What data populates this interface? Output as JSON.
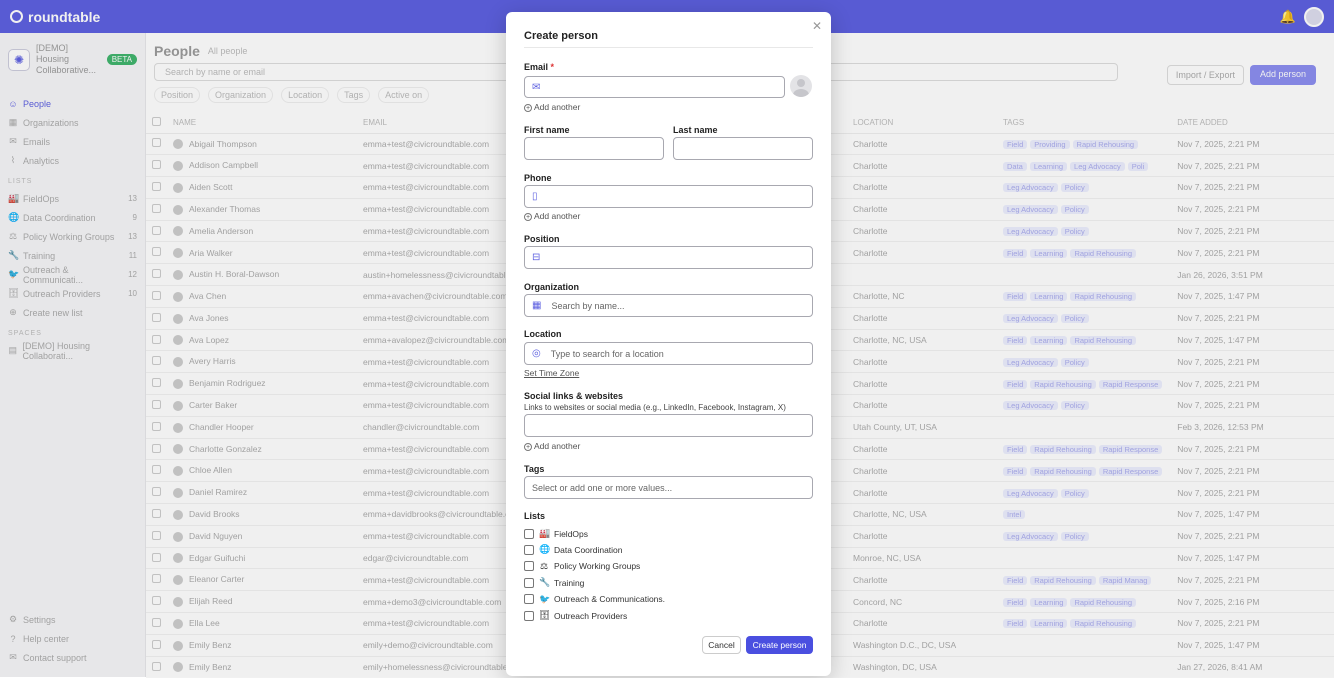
{
  "app": {
    "name": "roundtable"
  },
  "sidebar": {
    "workspace": {
      "name": "[DEMO] Housing Collaborative...",
      "badge": "BETA"
    },
    "nav": [
      {
        "label": "People",
        "icon": "people-icon",
        "active": true
      },
      {
        "label": "Organizations",
        "icon": "building-icon"
      },
      {
        "label": "Emails",
        "icon": "mail-icon"
      },
      {
        "label": "Analytics",
        "icon": "chart-icon"
      }
    ],
    "lists_heading": "LISTS",
    "lists": [
      {
        "label": "FieldOps",
        "count": "13"
      },
      {
        "label": "Data Coordination",
        "count": "9"
      },
      {
        "label": "Policy Working Groups",
        "count": "13"
      },
      {
        "label": "Training",
        "count": "11"
      },
      {
        "label": "Outreach & Communicati...",
        "count": "12"
      },
      {
        "label": "Outreach Providers",
        "count": "10"
      },
      {
        "label": "Create new list"
      }
    ],
    "spaces_heading": "SPACES",
    "spaces": [
      {
        "label": "[DEMO] Housing Collaborati..."
      }
    ],
    "bottom": [
      {
        "label": "Settings"
      },
      {
        "label": "Help center"
      },
      {
        "label": "Contact support"
      }
    ]
  },
  "main": {
    "title": "People",
    "subtitle": "All people",
    "search_placeholder": "Search by name or email",
    "import_export": "Import / Export",
    "add_person": "Add person",
    "filters": [
      "Position",
      "Organization",
      "Location",
      "Tags",
      "Active on"
    ],
    "columns": [
      "NAME",
      "EMAIL",
      "LOCATION",
      "TAGS",
      "DATE ADDED"
    ],
    "rows": [
      {
        "name": "Abigail Thompson",
        "email": "emma+test@civicroundtable.com",
        "location": "Charlotte",
        "tags": [
          "Field",
          "Providing",
          "Rapid Rehousing"
        ],
        "date": "Nov 7, 2025, 2:21 PM"
      },
      {
        "name": "Addison Campbell",
        "email": "emma+test@civicroundtable.com",
        "location": "Charlotte",
        "tags": [
          "Data",
          "Learning",
          "Leg Advocacy",
          "Poli"
        ],
        "date": "Nov 7, 2025, 2:21 PM"
      },
      {
        "name": "Aiden Scott",
        "email": "emma+test@civicroundtable.com",
        "location": "Charlotte",
        "tags": [
          "Leg Advocacy",
          "Policy"
        ],
        "date": "Nov 7, 2025, 2:21 PM"
      },
      {
        "name": "Alexander Thomas",
        "email": "emma+test@civicroundtable.com",
        "location": "Charlotte",
        "tags": [
          "Leg Advocacy",
          "Policy"
        ],
        "date": "Nov 7, 2025, 2:21 PM"
      },
      {
        "name": "Amelia Anderson",
        "email": "emma+test@civicroundtable.com",
        "location": "Charlotte",
        "tags": [
          "Leg Advocacy",
          "Policy"
        ],
        "date": "Nov 7, 2025, 2:21 PM"
      },
      {
        "name": "Aria Walker",
        "email": "emma+test@civicroundtable.com",
        "location": "Charlotte",
        "tags": [
          "Field",
          "Learning",
          "Rapid Rehousing"
        ],
        "date": "Nov 7, 2025, 2:21 PM"
      },
      {
        "name": "Austin H. Boral-Dawson",
        "email": "austin+homelessness@civicroundtable",
        "location": "",
        "tags": [],
        "date": "Jan 26, 2026, 3:51 PM"
      },
      {
        "name": "Ava Chen",
        "email": "emma+avachen@civicroundtable.com",
        "location": "Charlotte, NC",
        "tags": [
          "Field",
          "Learning",
          "Rapid Rehousing"
        ],
        "date": "Nov 7, 2025, 1:47 PM"
      },
      {
        "name": "Ava Jones",
        "email": "emma+test@civicroundtable.com",
        "location": "Charlotte",
        "tags": [
          "Leg Advocacy",
          "Policy"
        ],
        "date": "Nov 7, 2025, 2:21 PM"
      },
      {
        "name": "Ava Lopez",
        "email": "emma+avalopez@civicroundtable.com",
        "location": "Charlotte, NC, USA",
        "tags": [
          "Field",
          "Learning",
          "Rapid Rehousing"
        ],
        "date": "Nov 7, 2025, 1:47 PM"
      },
      {
        "name": "Avery Harris",
        "email": "emma+test@civicroundtable.com",
        "location": "Charlotte",
        "tags": [
          "Leg Advocacy",
          "Policy"
        ],
        "date": "Nov 7, 2025, 2:21 PM"
      },
      {
        "name": "Benjamin Rodriguez",
        "email": "emma+test@civicroundtable.com",
        "location": "Charlotte",
        "tags": [
          "Field",
          "Rapid Rehousing",
          "Rapid Response"
        ],
        "date": "Nov 7, 2025, 2:21 PM"
      },
      {
        "name": "Carter Baker",
        "email": "emma+test@civicroundtable.com",
        "location": "Charlotte",
        "tags": [
          "Leg Advocacy",
          "Policy"
        ],
        "date": "Nov 7, 2025, 2:21 PM"
      },
      {
        "name": "Chandler Hooper",
        "email": "chandler@civicroundtable.com",
        "location": "Utah County, UT, USA",
        "tags": [],
        "date": "Feb 3, 2026, 12:53 PM"
      },
      {
        "name": "Charlotte Gonzalez",
        "email": "emma+test@civicroundtable.com",
        "location": "Charlotte",
        "tags": [
          "Field",
          "Rapid Rehousing",
          "Rapid Response"
        ],
        "date": "Nov 7, 2025, 2:21 PM"
      },
      {
        "name": "Chloe Allen",
        "email": "emma+test@civicroundtable.com",
        "location": "Charlotte",
        "tags": [
          "Field",
          "Rapid Rehousing",
          "Rapid Response"
        ],
        "date": "Nov 7, 2025, 2:21 PM"
      },
      {
        "name": "Daniel Ramirez",
        "email": "emma+test@civicroundtable.com",
        "location": "Charlotte",
        "tags": [
          "Leg Advocacy",
          "Policy"
        ],
        "date": "Nov 7, 2025, 2:21 PM"
      },
      {
        "name": "David Brooks",
        "email": "emma+davidbrooks@civicroundtable.c",
        "location": "Charlotte, NC, USA",
        "tags": [
          "Intel"
        ],
        "date": "Nov 7, 2025, 1:47 PM"
      },
      {
        "name": "David Nguyen",
        "email": "emma+test@civicroundtable.com",
        "location": "Charlotte",
        "tags": [
          "Leg Advocacy",
          "Policy"
        ],
        "date": "Nov 7, 2025, 2:21 PM"
      },
      {
        "name": "Edgar Guifuchi",
        "email": "edgar@civicroundtable.com",
        "location": "Monroe, NC, USA",
        "tags": [],
        "date": "Nov 7, 2025, 1:47 PM"
      },
      {
        "name": "Eleanor Carter",
        "email": "emma+test@civicroundtable.com",
        "location": "Charlotte",
        "tags": [
          "Field",
          "Rapid Rehousing",
          "Rapid Manag"
        ],
        "date": "Nov 7, 2025, 2:21 PM"
      },
      {
        "name": "Elijah Reed",
        "email": "emma+demo3@civicroundtable.com",
        "location": "Concord, NC",
        "tags": [
          "Field",
          "Learning",
          "Rapid Rehousing"
        ],
        "date": "Nov 7, 2025, 2:16 PM"
      },
      {
        "name": "Ella Lee",
        "email": "emma+test@civicroundtable.com",
        "location": "Charlotte",
        "tags": [
          "Field",
          "Learning",
          "Rapid Rehousing"
        ],
        "date": "Nov 7, 2025, 2:21 PM"
      },
      {
        "name": "Emily Benz",
        "email": "emily+demo@civicroundtable.com",
        "location": "Washington D.C., DC, USA",
        "tags": [],
        "date": "Nov 7, 2025, 1:47 PM"
      },
      {
        "name": "Emily Benz",
        "email": "emily+homelessness@civicroundtable.",
        "location": "Washington, DC, USA",
        "tags": [],
        "date": "Jan 27, 2026, 8:41 AM"
      }
    ]
  },
  "modal": {
    "title": "Create person",
    "email": {
      "label": "Email",
      "required_mark": "*",
      "value": ""
    },
    "add_another": "Add another",
    "first_name": {
      "label": "First name",
      "value": ""
    },
    "last_name": {
      "label": "Last name",
      "value": ""
    },
    "phone": {
      "label": "Phone",
      "value": ""
    },
    "position": {
      "label": "Position",
      "value": ""
    },
    "organization": {
      "label": "Organization",
      "placeholder": "Search by name..."
    },
    "location": {
      "label": "Location",
      "placeholder": "Type to search for a location",
      "set_time_zone": "Set Time Zone"
    },
    "social": {
      "label": "Social links & websites",
      "helper": "Links to websites or social media (e.g., LinkedIn, Facebook, Instagram, X)"
    },
    "tags": {
      "label": "Tags",
      "placeholder": "Select or add one or more values..."
    },
    "lists": {
      "label": "Lists",
      "items": [
        {
          "label": "FieldOps",
          "emoji": "🏭"
        },
        {
          "label": "Data Coordination",
          "emoji": "🌐"
        },
        {
          "label": "Policy Working Groups",
          "emoji": "⚖"
        },
        {
          "label": "Training",
          "emoji": "🔧"
        },
        {
          "label": "Outreach & Communications.",
          "emoji": "🐦"
        },
        {
          "label": "Outreach Providers",
          "emoji": "🗄"
        }
      ]
    },
    "cancel": "Cancel",
    "create": "Create person"
  },
  "colors": {
    "brand": "#5b5ee0",
    "primary_button": "#4a4fe0"
  }
}
